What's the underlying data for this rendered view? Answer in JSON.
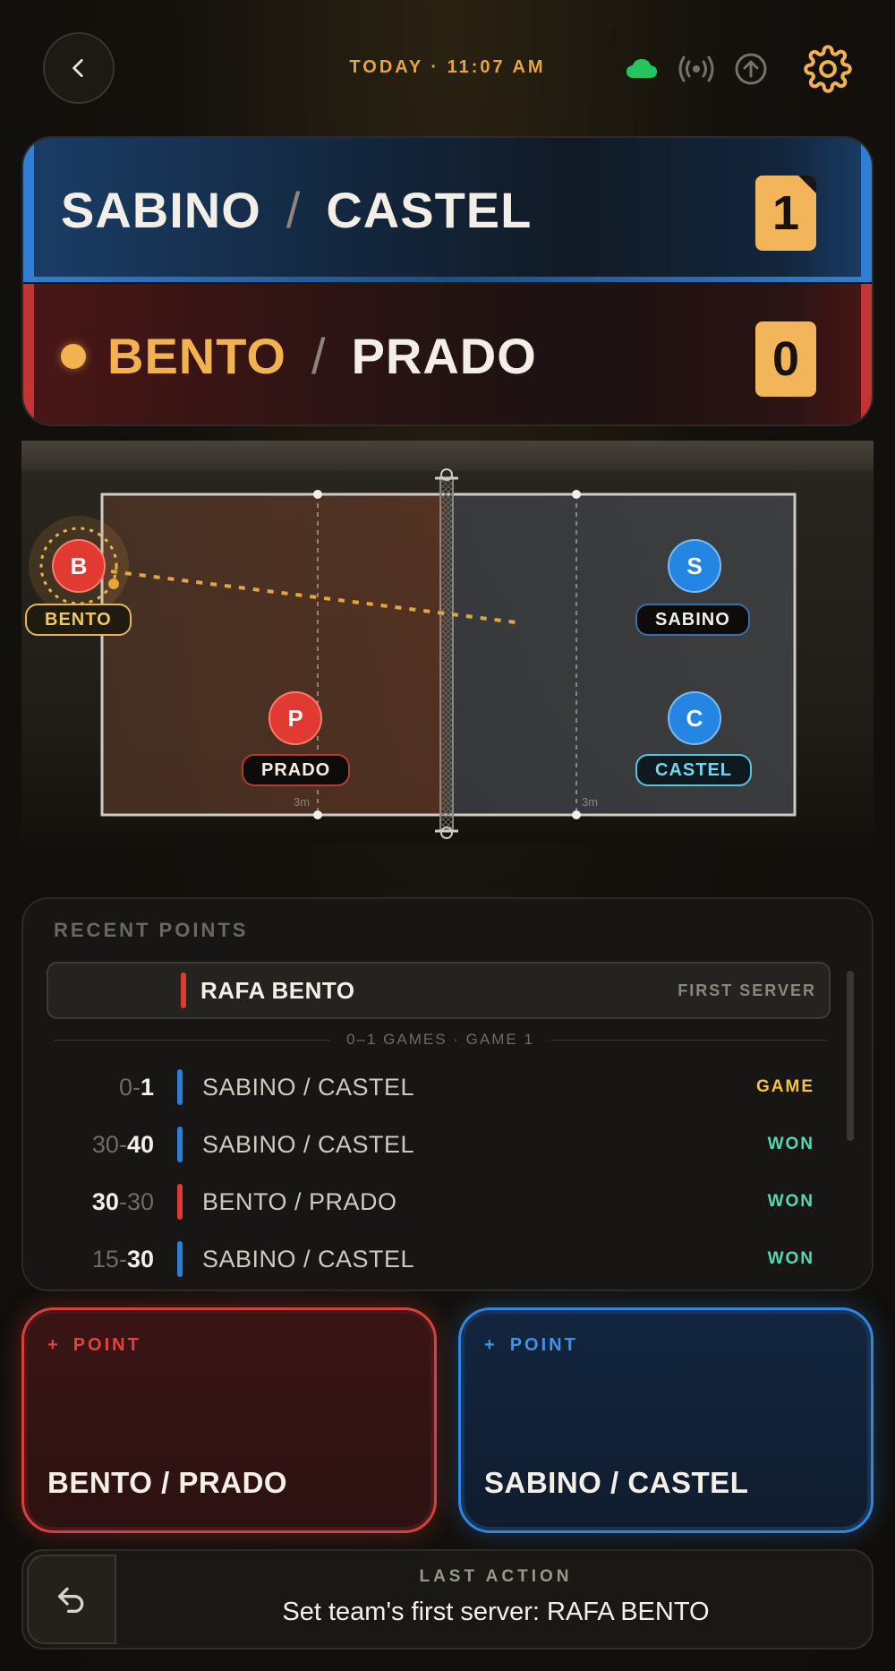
{
  "header": {
    "datetime": "TODAY · 11:07 AM",
    "icons": [
      "chevron-left-icon",
      "cloud-icon",
      "broadcast-icon",
      "upload-icon",
      "gear-icon"
    ],
    "cloud_color": "#22c55e",
    "accent_color": "#f1b24f"
  },
  "scoreboard": {
    "top_team": {
      "player1": "SABINO",
      "separator": "/",
      "player2": "CASTEL",
      "score": "1",
      "color": "#2f7fd6"
    },
    "bottom_team": {
      "player1": "BENTO",
      "separator": "/",
      "player2": "PRADO",
      "score": "0",
      "color": "#c43434",
      "serving": true
    }
  },
  "court": {
    "players": {
      "bento": {
        "initial": "B",
        "name": "BENTO"
      },
      "prado": {
        "initial": "P",
        "name": "PRADO"
      },
      "sabino": {
        "initial": "S",
        "name": "SABINO"
      },
      "castel": {
        "initial": "C",
        "name": "CASTEL"
      }
    },
    "mark_left": "3m",
    "mark_right": "3m"
  },
  "recent_points": {
    "title": "RECENT POINTS",
    "first_server": {
      "name": "RAFA BENTO",
      "tag": "FIRST SERVER"
    },
    "games_separator": "0–1 GAMES · GAME 1",
    "rows": [
      {
        "score_left": "0",
        "score_right": "1",
        "team": "SABINO / CASTEL",
        "result": "GAME"
      },
      {
        "score_left": "30",
        "score_right": "40",
        "team": "SABINO / CASTEL",
        "result": "WON"
      },
      {
        "score_left": "30",
        "score_right": "30",
        "team": "BENTO / PRADO",
        "result": "WON"
      },
      {
        "score_left": "15",
        "score_right": "30",
        "team": "SABINO / CASTEL",
        "result": "WON"
      }
    ]
  },
  "point_buttons": {
    "left": {
      "label": "POINT",
      "team": "BENTO / PRADO"
    },
    "right": {
      "label": "POINT",
      "team": "SABINO / CASTEL"
    }
  },
  "last_action": {
    "label": "LAST ACTION",
    "text": "Set team's first server: RAFA BENTO"
  }
}
